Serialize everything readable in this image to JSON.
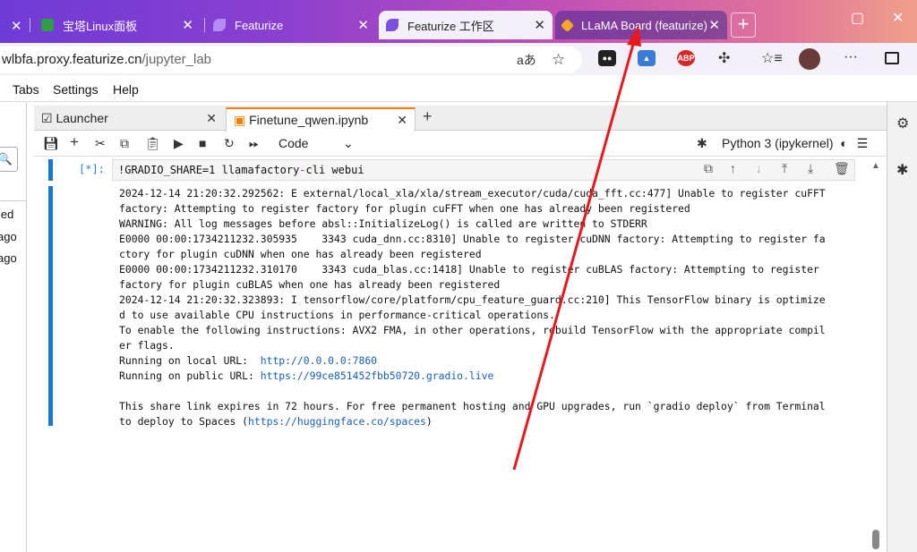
{
  "browser": {
    "tabs": [
      {
        "label": "宝塔Linux面板",
        "icon": "bt-panel-icon"
      },
      {
        "label": "Featurize",
        "icon": "featurize-icon"
      },
      {
        "label": "Featurize 工作区",
        "icon": "featurize-icon"
      },
      {
        "label": "LLaMA Board (featurize)",
        "icon": "llama-board-icon"
      }
    ],
    "close_glyph": "✕",
    "new_tab_glyph": "+",
    "address": {
      "host": "wlbfa.proxy.featurize.cn",
      "path": "/jupyter_lab"
    },
    "extensions": [
      "ABP"
    ],
    "accent_colors": {
      "tabstrip_start": "#6e3bd6",
      "tabstrip_end": "#f0a08a",
      "highlight_tab": "#46288c"
    }
  },
  "jupyter": {
    "menu": [
      "Tabs",
      "Settings",
      "Help"
    ],
    "left_panel": {
      "search_glyph": "🔍",
      "items": [
        "ied",
        "ago",
        "ago"
      ]
    },
    "tabs": [
      {
        "label": "Launcher"
      },
      {
        "label": "Finetune_qwen.ipynb"
      }
    ],
    "toolbar": {
      "cell_type": "Code",
      "kernel": "Python 3 (ipykernel)"
    },
    "cell": {
      "prompt": "[*]:",
      "code_prefix": "!GRADIO_SHARE=1 llamafactory",
      "code_dash": "-",
      "code_suffix": "cli webui"
    },
    "output_lines": [
      "2024-12-14 21:20:32.292562: E external/local_xla/xla/stream_executor/cuda/cuda_fft.cc:477] Unable to register cuFFT",
      "factory: Attempting to register factory for plugin cuFFT when one has already been registered",
      "WARNING: All log messages before absl::InitializeLog() is called are written to STDERR",
      "E0000 00:00:1734211232.305935    3343 cuda_dnn.cc:8310] Unable to register cuDNN factory: Attempting to register fa",
      "ctory for plugin cuDNN when one has already been registered",
      "E0000 00:00:1734211232.310170    3343 cuda_blas.cc:1418] Unable to register cuBLAS factory: Attempting to register",
      "factory for plugin cuBLAS when one has already been registered",
      "2024-12-14 21:20:32.323893: I tensorflow/core/platform/cpu_feature_guard.cc:210] This TensorFlow binary is optimize",
      "d to use available CPU instructions in performance-critical operations.",
      "To enable the following instructions: AVX2 FMA, in other operations, rebuild TensorFlow with the appropriate compil",
      "er flags."
    ],
    "local_url_label": "Running on local URL:  ",
    "local_url": "http://0.0.0.0:7860",
    "public_url_label": "Running on public URL: ",
    "public_url": "https://99ce851452fbb50720.gradio.live",
    "share_line1": "This share link expires in 72 hours. For free permanent hosting and GPU upgrades, run `gradio deploy` from Terminal",
    "share_line2_prefix": "to deploy to Spaces (",
    "share_link": "https://huggingface.co/spaces",
    "share_line2_suffix": ")"
  }
}
